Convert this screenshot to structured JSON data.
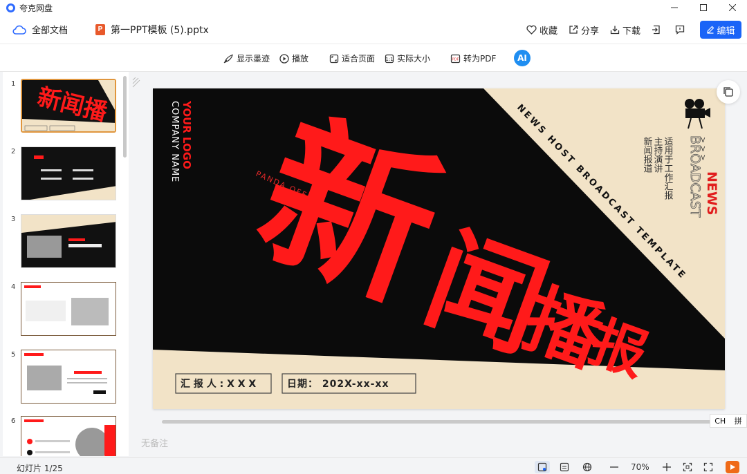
{
  "window": {
    "title": "夸克网盘"
  },
  "tabbar": {
    "all_docs": "全部文档",
    "file_icon": "P",
    "file_name": "第一PPT模板 (5).pptx",
    "actions": {
      "favorite": "收藏",
      "share": "分享",
      "download": "下载",
      "edit": "编辑"
    }
  },
  "viewbar": {
    "show_ink": "显示墨迹",
    "play": "播放",
    "fit_page": "适合页面",
    "actual_size": "实际大小",
    "to_pdf": "转为PDF",
    "ai_label": "AI"
  },
  "thumbnails": [
    "1",
    "2",
    "3",
    "4",
    "5",
    "6"
  ],
  "slide": {
    "logo": "YOUR LOGO",
    "company": "COMPANY NAME",
    "brand": "PANDA OFFICE",
    "title_a": "新",
    "title_b": "闻",
    "title_c": "播",
    "title_d": "报",
    "diagonal_text": "NEWS HOST BROADCAST TEMPLATE",
    "news": "NEWS",
    "broadcast": "BROADCAST",
    "arrows": "> > >",
    "desc1": "适用于工作汇报",
    "desc2": "主持演讲",
    "desc3": "新闻报道",
    "reporter": "汇 报 人 : X X X",
    "date": "日期： 202X-xx-xx",
    "accent_red": "#ff1a1a",
    "bg_cream": "#f2e3c7"
  },
  "ime": {
    "lang": "CH",
    "mode": "拼"
  },
  "notes": {
    "placeholder": "无备注"
  },
  "statusbar": {
    "slide_count": "幻灯片 1/25",
    "zoom": "70%"
  },
  "colors": {
    "primary": "#1a64f7",
    "play": "#ef6a18"
  }
}
